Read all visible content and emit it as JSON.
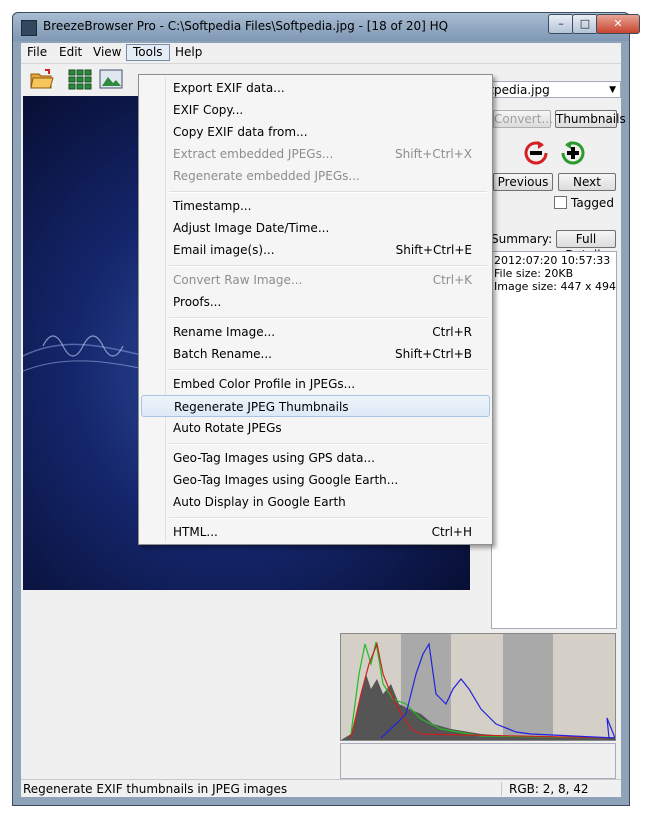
{
  "window": {
    "title": "BreezeBrowser Pro - C:\\Softpedia Files\\Softpedia.jpg - [18 of 20] HQ",
    "minimize": "–",
    "maximize": "□",
    "close": "✕"
  },
  "menubar": {
    "file": "File",
    "edit": "Edit",
    "view": "View",
    "tools": "Tools",
    "help": "Help"
  },
  "side": {
    "filename": "oftpedia.jpg",
    "convert": "Convert...",
    "thumbnails": "Thumbnails",
    "previous": "Previous",
    "next": "Next",
    "tagged": "Tagged",
    "summary_label": "Summary:",
    "full_details": "Full Details",
    "summary_lines": [
      "2012:07:20 10:57:33",
      "File size: 20KB",
      "Image size: 447 x 494"
    ]
  },
  "tools_menu": [
    {
      "label": "Export EXIF data...",
      "shortcut": "",
      "disabled": false
    },
    {
      "label": "EXIF Copy...",
      "shortcut": "",
      "disabled": false
    },
    {
      "label": "Copy EXIF data from...",
      "shortcut": "",
      "disabled": false
    },
    {
      "label": "Extract embedded JPEGs...",
      "shortcut": "Shift+Ctrl+X",
      "disabled": true
    },
    {
      "label": "Regenerate embedded JPEGs...",
      "shortcut": "",
      "disabled": true
    },
    {
      "label": "Timestamp...",
      "shortcut": "",
      "disabled": false
    },
    {
      "label": "Adjust Image Date/Time...",
      "shortcut": "",
      "disabled": false
    },
    {
      "label": "Email image(s)...",
      "shortcut": "Shift+Ctrl+E",
      "disabled": false
    },
    {
      "label": "Convert Raw Image...",
      "shortcut": "Ctrl+K",
      "disabled": true
    },
    {
      "label": "Proofs...",
      "shortcut": "",
      "disabled": false
    },
    {
      "label": "Rename Image...",
      "shortcut": "Ctrl+R",
      "disabled": false
    },
    {
      "label": "Batch Rename...",
      "shortcut": "Shift+Ctrl+B",
      "disabled": false
    },
    {
      "label": "Embed Color Profile in JPEGs...",
      "shortcut": "",
      "disabled": false
    },
    {
      "label": "Regenerate JPEG Thumbnails",
      "shortcut": "",
      "disabled": false,
      "highlighted": true
    },
    {
      "label": "Auto Rotate JPEGs",
      "shortcut": "",
      "disabled": false
    },
    {
      "label": "Geo-Tag Images using GPS data...",
      "shortcut": "",
      "disabled": false
    },
    {
      "label": "Geo-Tag Images using Google Earth...",
      "shortcut": "",
      "disabled": false
    },
    {
      "label": "Auto Display in Google Earth",
      "shortcut": "",
      "disabled": false
    },
    {
      "label": "HTML...",
      "shortcut": "Ctrl+H",
      "disabled": false
    }
  ],
  "status": {
    "text": "Regenerate EXIF thumbnails in JPEG images",
    "rgb": "RGB:  2, 8, 42"
  },
  "icons": {
    "toolbar": [
      "open-folder-icon",
      "thumbnail-grid-icon",
      "image-icon"
    ],
    "nav": [
      "rotate-left-icon",
      "rotate-right-icon"
    ]
  }
}
